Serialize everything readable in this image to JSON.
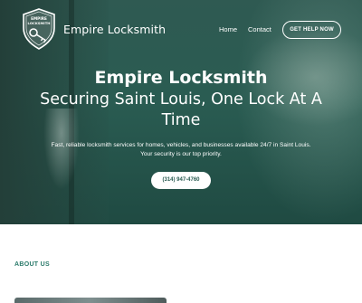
{
  "header": {
    "logo": {
      "top_text": "EMPIRE",
      "bottom_text": "LOCKSMITH",
      "icon": "key-shield-icon"
    },
    "brand_name": "Empire Locksmith",
    "nav": [
      {
        "label": "Home"
      },
      {
        "label": "Contact"
      }
    ],
    "cta_label": "GET HELP NOW"
  },
  "hero": {
    "title": "Empire Locksmith",
    "subtitle": "Securing Saint Louis, One Lock At A Time",
    "description": "Fast, reliable locksmith services for homes, vehicles, and businesses available 24/7 in Saint Louis. Your security is our top priority.",
    "phone_label": "(314) 947-4760"
  },
  "about": {
    "label": "ABOUT US"
  },
  "colors": {
    "hero_bg": "#2a5c52",
    "accent": "#2a7a6a",
    "text_light": "#ffffff"
  }
}
